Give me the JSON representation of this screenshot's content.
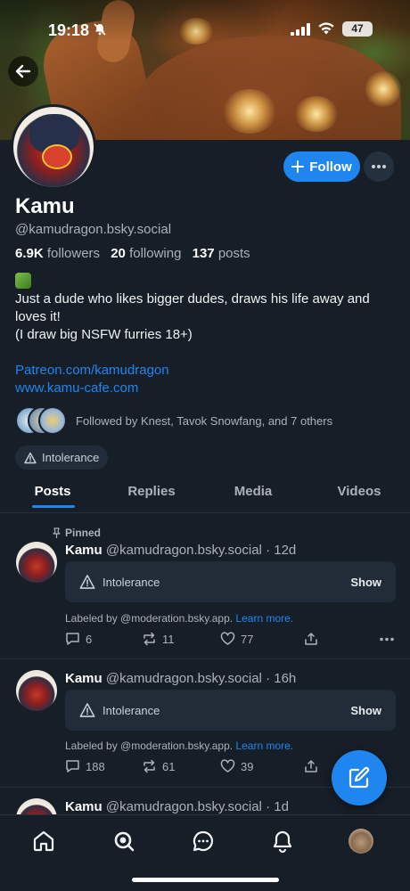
{
  "status_bar": {
    "time": "19:18",
    "battery": "47"
  },
  "profile": {
    "name": "Kamu",
    "handle": "@kamudragon.bsky.social",
    "followers_count": "6.9K",
    "followers_label": "followers",
    "following_count": "20",
    "following_label": "following",
    "posts_count": "137",
    "posts_label": "posts",
    "bio_lines": [
      "Just a dude who likes bigger dudes, draws his life away and loves it!",
      "(I draw big NSFW furries 18+)"
    ],
    "links": [
      "Patreon.com/kamudragon",
      "www.kamu-cafe.com"
    ],
    "followed_by": "Followed by Knest, Tavok Snowfang, and 7 others",
    "label_chip": "Intolerance",
    "follow_button": "Follow"
  },
  "tabs": [
    {
      "label": "Posts",
      "active": true
    },
    {
      "label": "Replies"
    },
    {
      "label": "Media"
    },
    {
      "label": "Videos"
    }
  ],
  "posts": [
    {
      "pinned_label": "Pinned",
      "author": "Kamu",
      "handle": "@kamudragon.bsky.social",
      "age": "· 12d",
      "warning": "Intolerance",
      "show": "Show",
      "labeled_by": "Labeled by @moderation.bsky.app.",
      "learn_more": "Learn more.",
      "replies": "6",
      "reposts": "11",
      "likes": "77"
    },
    {
      "author": "Kamu",
      "handle": "@kamudragon.bsky.social",
      "age": "· 16h",
      "warning": "Intolerance",
      "show": "Show",
      "labeled_by": "Labeled by @moderation.bsky.app.",
      "learn_more": "Learn more.",
      "replies": "188",
      "reposts": "61",
      "likes": "39"
    },
    {
      "author": "Kamu",
      "handle": "@kamudragon.bsky.social",
      "age": "· 1d"
    }
  ],
  "icons": {
    "back": "arrow-left-icon",
    "more": "ellipsis-icon",
    "warning": "warning-triangle-icon",
    "pin": "pin-icon",
    "reply": "speech-bubble-icon",
    "repost": "repost-icon",
    "like": "heart-icon",
    "share": "share-icon",
    "compose": "compose-icon",
    "nav": [
      "home-icon",
      "search-icon",
      "chat-icon",
      "bell-icon",
      "profile-avatar"
    ]
  },
  "colors": {
    "background": "#161e27",
    "accent": "#1f86f0",
    "card": "#222c38",
    "muted": "#aab3bd"
  }
}
